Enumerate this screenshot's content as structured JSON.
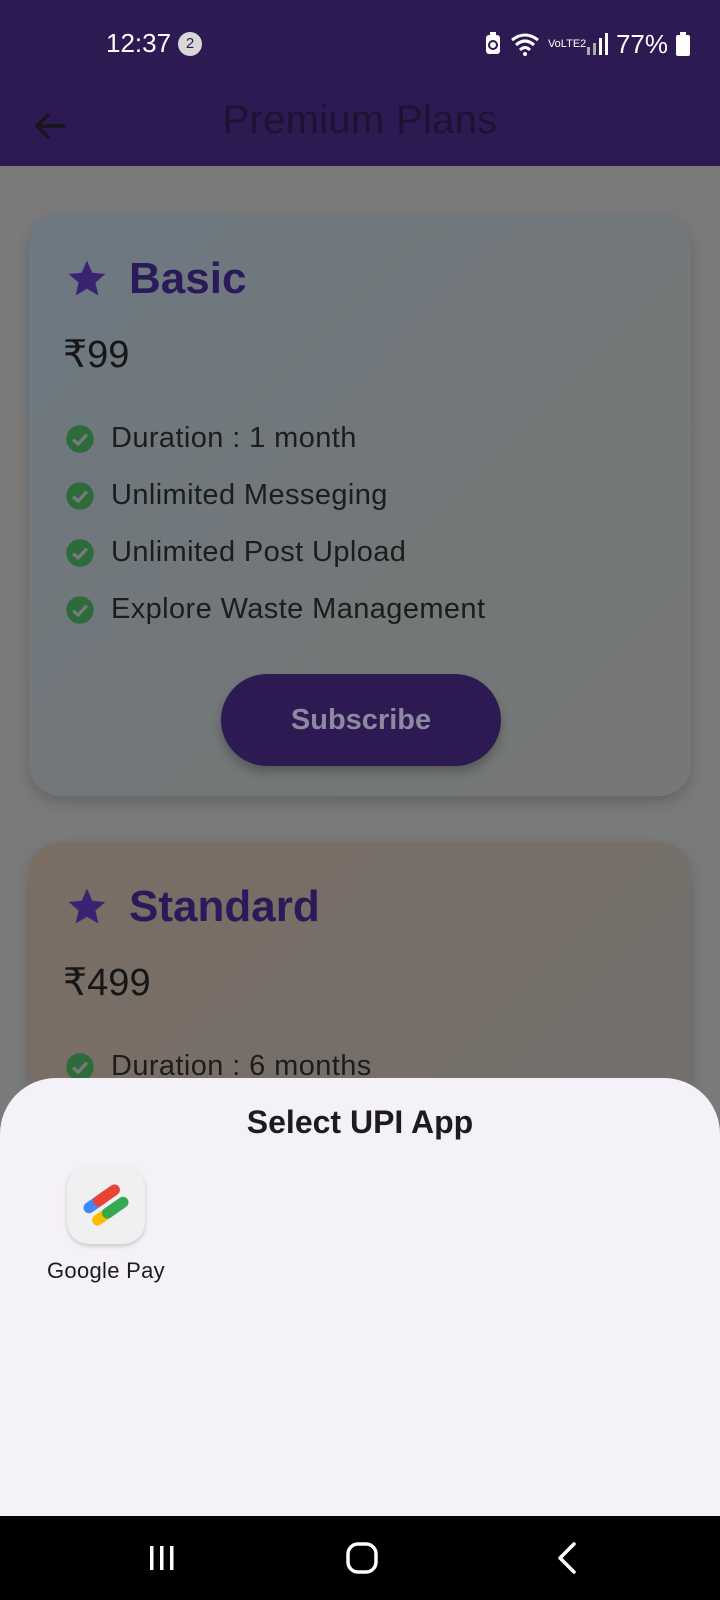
{
  "status_bar": {
    "time": "12:37",
    "notification_count": "2",
    "network_label": "VoLTE2",
    "battery_percent": "77%"
  },
  "app_bar": {
    "title": "Premium Plans",
    "back_icon": "arrow-left-icon"
  },
  "plans": [
    {
      "name": "Basic",
      "price": "₹99",
      "features": [
        "Duration : 1 month",
        "Unlimited Messeging",
        "Unlimited Post Upload",
        "Explore Waste Management"
      ],
      "subscribe_label": "Subscribe"
    },
    {
      "name": "Standard",
      "price": "₹499",
      "features": [
        "Duration : 6 months"
      ]
    }
  ],
  "upi_sheet": {
    "title": "Select UPI App",
    "apps": [
      {
        "label": "Google Pay",
        "icon": "google-pay-icon"
      }
    ]
  },
  "nav_bar": {
    "buttons": [
      "recents-icon",
      "home-icon",
      "back-icon"
    ]
  },
  "colors": {
    "app_bar": "#2e1a52",
    "plan_name": "#2b1a5a",
    "check": "#2e6b3a",
    "sheet_bg": "#f5f1f8"
  }
}
